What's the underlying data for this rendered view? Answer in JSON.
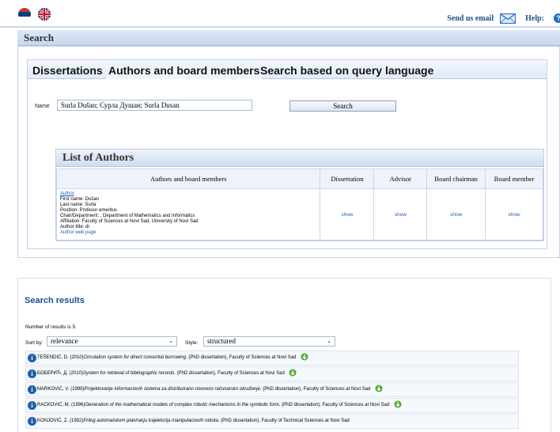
{
  "header": {
    "send_email": "Send us email",
    "help": "Help:",
    "help_icon_char": "?"
  },
  "search_section": {
    "title": "Search",
    "tabs": [
      {
        "label": "Dissertations"
      },
      {
        "label": "Authors and board members"
      },
      {
        "label": "Search based on query language"
      }
    ],
    "name_label": "Name",
    "name_value": "Surla Dušan; Сурла Душан; Surla Dusan",
    "search_button": "Search"
  },
  "authors_list": {
    "title": "List of Authors",
    "columns": [
      "Authors and board members",
      "Dissertation",
      "Advisor",
      "Board chairman",
      "Board member"
    ],
    "rows": [
      {
        "role": "Author",
        "first_name": "First name: Dušan",
        "last_name": "Last name: Surla",
        "position": "Position: Profesor emeritus",
        "chair": "Chair/Department: , Department of Mathematics and Informatics",
        "affiliation": "Affiliation: Faculty of Sciences at Novi Sad, University of Novi Sad",
        "author_title": "Author title: dr",
        "web_page": "Author web page",
        "dissertation": "show",
        "advisor": "show",
        "board_chairman": "show",
        "board_member": "show"
      }
    ]
  },
  "results": {
    "title": "Search results",
    "count_text": "Number of results is 5",
    "sort_label": "Sort by:",
    "sort_value": "relevance",
    "style_label": "Style:",
    "style_value": "structured",
    "items": [
      {
        "prefix": "TEŠENDIĆ, D. (2010)",
        "title": "Circulation system for direct consortial borrowing",
        "suffix": ". (PhD dissertation), Faculty of Sciences at Novi Sad"
      },
      {
        "prefix": "БОБЕРИЋ, Д. (2010)",
        "title": "System for retrieval of bibliographic records",
        "suffix": ". (PhD dissertation), Faculty of Sciences at Novi Sad"
      },
      {
        "prefix": "MARKOVIĆ, V. (1999)",
        "title": "Projektovanje informacionih sistema za distribuirano otvoreno računarsko okruženje",
        "suffix": ". (PhD dissertation), Faculty of Sciences at Novi Sad"
      },
      {
        "prefix": "RACKOVIĆ, M. (1996)",
        "title": "Generation of the mathematical models of complex robotic mechanisms in the symbolic form",
        "suffix": ". (PhD dissertation), Faculty of Sciences at Novi Sad"
      },
      {
        "prefix": "KONJOVIĆ, Z. (1992)",
        "title": "Prilog automatskom planiranju trajektorija manipulacionih robota",
        "suffix": ". (PhD dissertation), Faculty of Technical Sciences at Novi Sad"
      }
    ]
  },
  "colors": {
    "accent": "#1d4f95",
    "link": "#1f5fb8",
    "panel_border": "#c3d3ea",
    "download_green": "#4caf2a"
  }
}
